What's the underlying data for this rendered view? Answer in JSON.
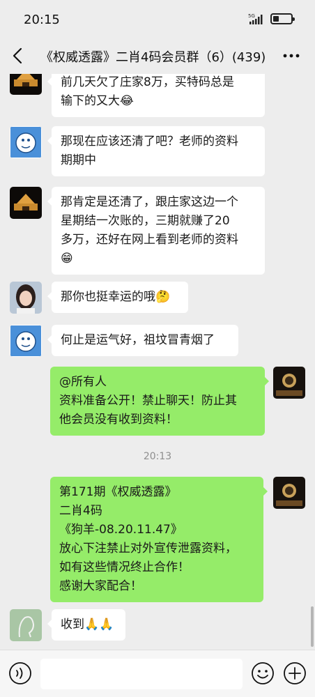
{
  "status_bar": {
    "time": "20:15",
    "network": "5G"
  },
  "header": {
    "title": "《权威透露》二肖4码会员群（6）(439)"
  },
  "messages": [
    {
      "side": "left",
      "sender": "castle-avatar",
      "text": "前几天欠了庄家8万，买特码总是\n输下的又大😂"
    },
    {
      "side": "left",
      "sender": "cartoon-avatar",
      "text": "那现在应该还清了吧？老师的资料\n期期中"
    },
    {
      "side": "left",
      "sender": "castle-avatar",
      "text": "那肯定是还清了，跟庄家这边一个\n星期结一次账的，三期就赚了20\n多万，还好在网上看到老师的资料\n😁"
    },
    {
      "side": "left",
      "sender": "girl-avatar",
      "text": "那你也挺幸运的哦🤔"
    },
    {
      "side": "left",
      "sender": "cartoon-avatar",
      "text": "何止是运气好，祖坟冒青烟了"
    },
    {
      "side": "right",
      "sender": "concert-avatar",
      "text": "@所有人\n资料准备公开！禁止聊天！防止其\n他会员没有收到资料！"
    },
    {
      "side": "right",
      "sender": "concert-avatar",
      "text": "第171期《权威透露》\n二肖4码\n《狗羊-08.20.11.47》\n放心下注禁止对外宣传泄露资料，\n如有这些情况终止合作！\n感谢大家配合！"
    },
    {
      "side": "left",
      "sender": "sketch-avatar",
      "text": "收到🙏🙏"
    }
  ],
  "timestamps": [
    "20:13"
  ],
  "input": {
    "value": "",
    "placeholder": ""
  },
  "colors": {
    "background": "#ededed",
    "bubble_left": "#ffffff",
    "bubble_right": "#95ec69",
    "timestamp_text": "#8e8e8e"
  },
  "icons": {
    "back": "chevron-left-icon",
    "more": "more-dots-icon",
    "voice": "voice-input-icon",
    "emoji": "emoji-icon",
    "plus": "plus-icon"
  }
}
